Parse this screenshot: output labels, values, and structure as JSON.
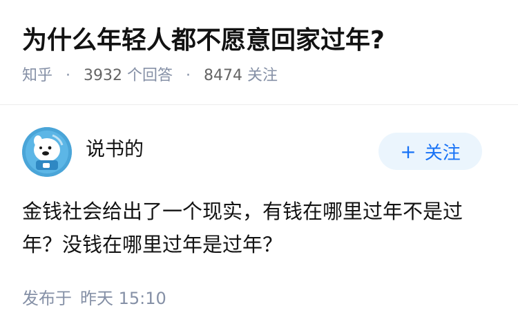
{
  "question": {
    "title": "为什么年轻人都不愿意回家过年?",
    "source": "知乎",
    "answer_count": "3932",
    "answer_label": "个回答",
    "follower_count": "8474",
    "follower_label": "关注"
  },
  "author": {
    "name": "说书的",
    "follow_plus": "+",
    "follow_label": "关注"
  },
  "answer": {
    "content": "金钱社会给出了一个现实，有钱在哪里过年不是过年？没钱在哪里过年是过年？",
    "published_label": "发布于",
    "published_time": "昨天 15:10"
  },
  "colors": {
    "title": "#121212",
    "meta": "#8590a6",
    "follow_bg": "#ebf5fd",
    "follow_text": "#1772f6",
    "avatar_bg": "#4aa5d8"
  }
}
